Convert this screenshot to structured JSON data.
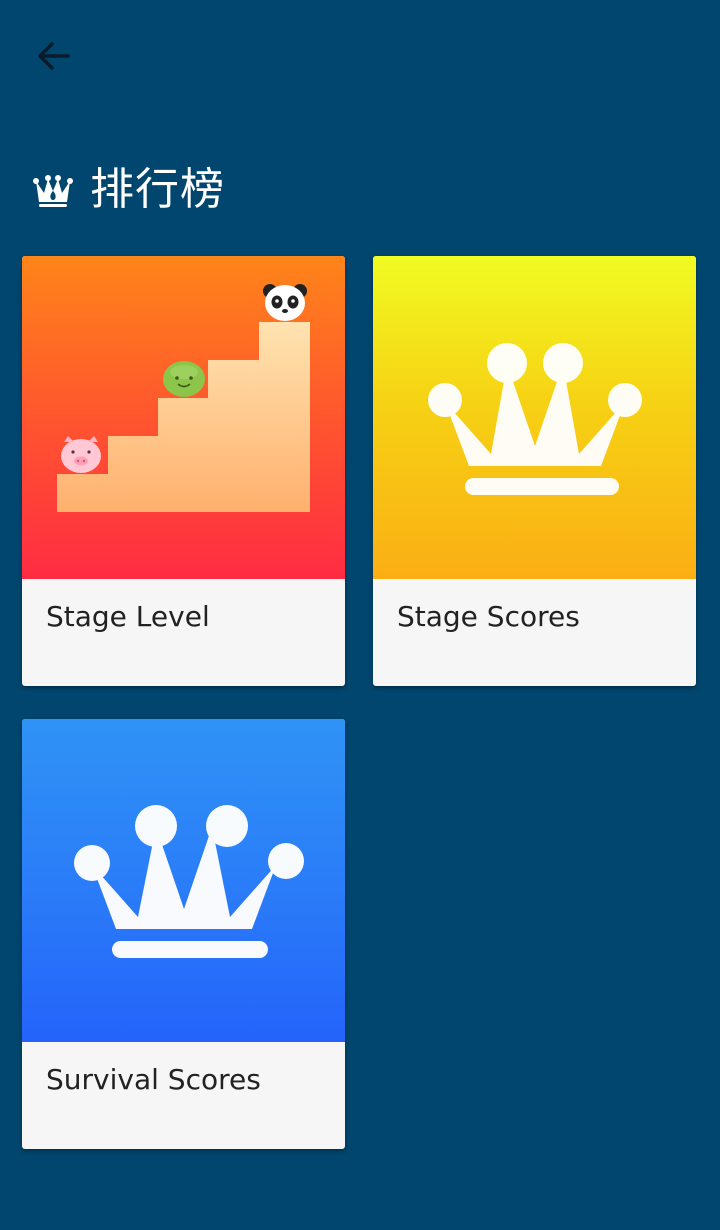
{
  "nav": {
    "back_icon": "arrow-left-icon"
  },
  "header": {
    "icon": "crown-icon",
    "title": "排行榜"
  },
  "cards": [
    {
      "label": "Stage Level",
      "art": "stairs-with-animals",
      "color_top": "#ff8519",
      "color_bottom": "#ff2c43"
    },
    {
      "label": "Stage Scores",
      "art": "crown-icon",
      "color_top": "#f1fb22",
      "color_bottom": "#fbae14"
    },
    {
      "label": "Survival Scores",
      "art": "crown-icon",
      "color_top": "#2f93f6",
      "color_bottom": "#2463fb"
    }
  ],
  "colors": {
    "background": "#01466e",
    "card_body": "#f6f6f6"
  }
}
